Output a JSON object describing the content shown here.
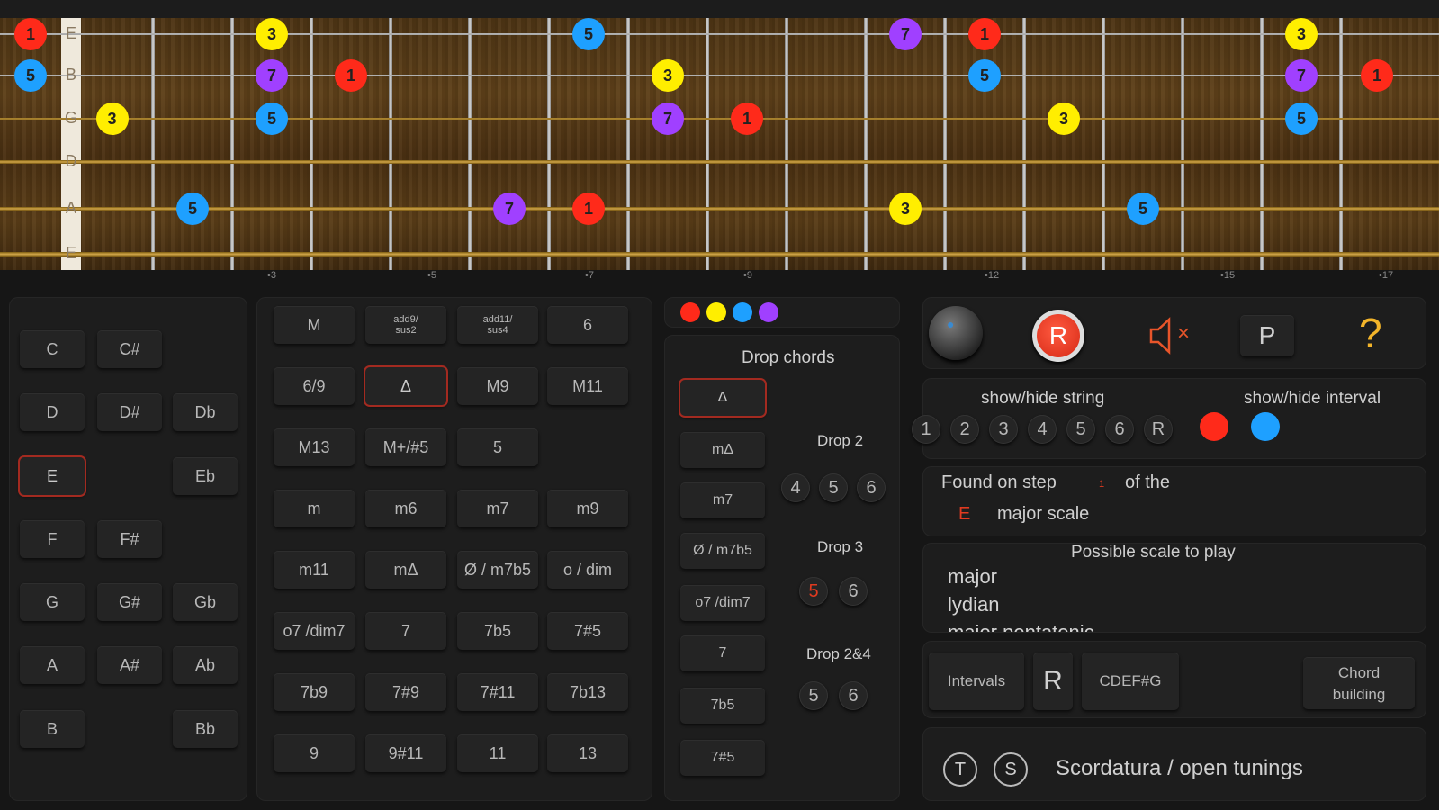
{
  "fretboard": {
    "strings": [
      "E",
      "B",
      "G",
      "D",
      "A",
      "E"
    ],
    "notes": [
      {
        "label": "1",
        "color": "#ff2a1a",
        "string": 0,
        "pos": "open"
      },
      {
        "label": "3",
        "color": "#ffee00",
        "string": 0,
        "pos": 3
      },
      {
        "label": "5",
        "color": "#1ea0ff",
        "string": 0,
        "pos": 7
      },
      {
        "label": "7",
        "color": "#a040ff",
        "string": 0,
        "pos": 11
      },
      {
        "label": "1",
        "color": "#ff2a1a",
        "string": 0,
        "pos": 12
      },
      {
        "label": "3",
        "color": "#ffee00",
        "string": 0,
        "pos": 16
      },
      {
        "label": "5",
        "color": "#1ea0ff",
        "string": 1,
        "pos": "open"
      },
      {
        "label": "7",
        "color": "#a040ff",
        "string": 1,
        "pos": 3
      },
      {
        "label": "1",
        "color": "#ff2a1a",
        "string": 1,
        "pos": 4
      },
      {
        "label": "3",
        "color": "#ffee00",
        "string": 1,
        "pos": 8
      },
      {
        "label": "5",
        "color": "#1ea0ff",
        "string": 1,
        "pos": 12
      },
      {
        "label": "7",
        "color": "#a040ff",
        "string": 1,
        "pos": 16
      },
      {
        "label": "1",
        "color": "#ff2a1a",
        "string": 1,
        "pos": 17
      },
      {
        "label": "3",
        "color": "#ffee00",
        "string": 2,
        "pos": 1
      },
      {
        "label": "5",
        "color": "#1ea0ff",
        "string": 2,
        "pos": 3
      },
      {
        "label": "7",
        "color": "#a040ff",
        "string": 2,
        "pos": 8
      },
      {
        "label": "1",
        "color": "#ff2a1a",
        "string": 2,
        "pos": 9
      },
      {
        "label": "3",
        "color": "#ffee00",
        "string": 2,
        "pos": 13
      },
      {
        "label": "5",
        "color": "#1ea0ff",
        "string": 2,
        "pos": 16
      },
      {
        "label": "5",
        "color": "#1ea0ff",
        "string": 4,
        "pos": 2
      },
      {
        "label": "7",
        "color": "#a040ff",
        "string": 4,
        "pos": 6
      },
      {
        "label": "1",
        "color": "#ff2a1a",
        "string": 4,
        "pos": 7
      },
      {
        "label": "3",
        "color": "#ffee00",
        "string": 4,
        "pos": 11
      },
      {
        "label": "5",
        "color": "#1ea0ff",
        "string": 4,
        "pos": 14
      }
    ],
    "fret_markers": [
      "3",
      "5",
      "7",
      "9",
      "12",
      "15",
      "17"
    ]
  },
  "roots": {
    "rows": [
      [
        "C",
        "C#",
        ""
      ],
      [
        "D",
        "D#",
        "Db"
      ],
      [
        "E",
        "",
        "Eb"
      ],
      [
        "F",
        "F#",
        ""
      ],
      [
        "G",
        "G#",
        "Gb"
      ],
      [
        "A",
        "A#",
        "Ab"
      ],
      [
        "B",
        "",
        "Bb"
      ]
    ],
    "selected": "E"
  },
  "chord_types": {
    "rows": [
      [
        "M",
        "add9/\nsus2",
        "add11/\nsus4",
        "6"
      ],
      [
        "6/9",
        "Δ",
        "M9",
        "M11"
      ],
      [
        "M13",
        "M+/#5",
        "5",
        ""
      ],
      [
        "m",
        "m6",
        "m7",
        "m9"
      ],
      [
        "m11",
        "mΔ",
        "Ø / m7b5",
        "o / dim"
      ],
      [
        "o7 /dim7",
        "7",
        "7b5",
        "7#5"
      ],
      [
        "7b9",
        "7#9",
        "7#11",
        "7b13"
      ],
      [
        "9",
        "9#11",
        "11",
        "13"
      ]
    ],
    "selected": "Δ"
  },
  "drop_chords": {
    "legend_colors": [
      "#ff2a1a",
      "#ffee00",
      "#1ea0ff",
      "#a040ff"
    ],
    "title": "Drop chords",
    "list": [
      "Δ",
      "mΔ",
      "m7",
      "Ø / m7b5",
      "o7 /dim7",
      "7",
      "7b5",
      "7#5"
    ],
    "selected": "Δ",
    "drop2": {
      "label": "Drop 2",
      "items": [
        "4",
        "5",
        "6"
      ]
    },
    "drop3": {
      "label": "Drop 3",
      "items": [
        "5",
        "6"
      ],
      "active": "5"
    },
    "drop24": {
      "label": "Drop 2&4",
      "items": [
        "5",
        "6"
      ]
    }
  },
  "toolbar": {
    "record": "R",
    "mute_x": "×",
    "p": "P",
    "help": "?"
  },
  "show_hide": {
    "string_label": "show/hide string",
    "interval_label": "show/hide interval",
    "strings": [
      "1",
      "2",
      "3",
      "4",
      "5",
      "6",
      "R"
    ],
    "interval_colors": [
      "#ff2a1a",
      "#1ea0ff"
    ]
  },
  "found": {
    "prefix": "Found on step",
    "step": "1",
    "suffix": "of the",
    "key": "E",
    "scale": "major scale"
  },
  "possible": {
    "title": "Possible scale to play",
    "scales": [
      "major",
      "lydian",
      "major pentatonic"
    ]
  },
  "modes": {
    "intervals": "Intervals",
    "r": "R",
    "notes": "CDEF#G",
    "chord_building": "Chord\nbuilding"
  },
  "tunings": {
    "t": "T",
    "s": "S",
    "label": "Scordatura / open tunings"
  }
}
